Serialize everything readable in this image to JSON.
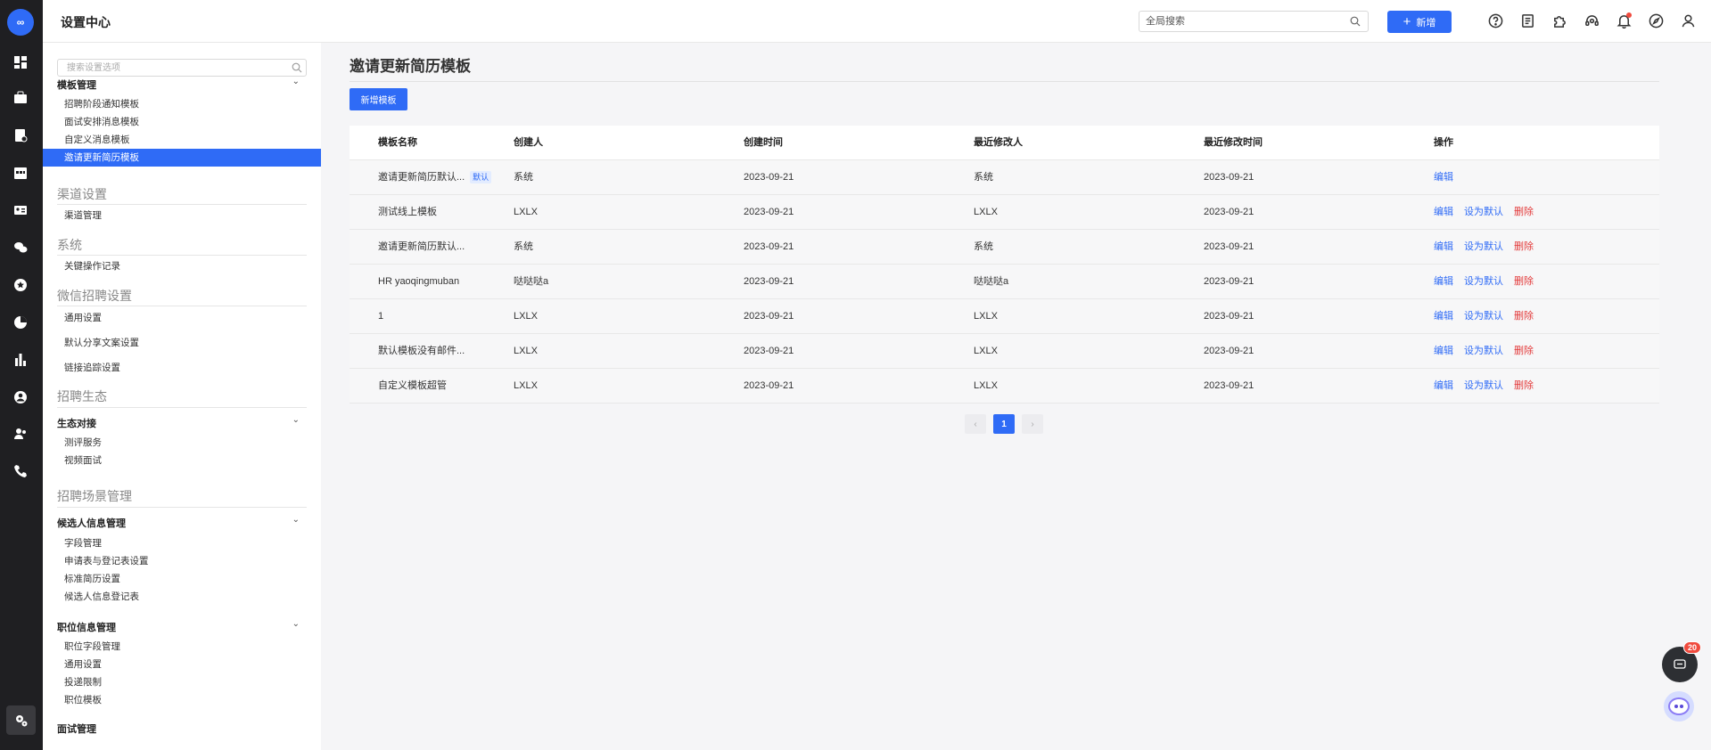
{
  "app": {
    "logo_text": "∞",
    "title": "设置中心"
  },
  "header": {
    "search_placeholder": "全局搜索",
    "new_label": "新增"
  },
  "sidebar": {
    "search_placeholder": "搜索设置选项",
    "template_group": "模板管理",
    "template_items": [
      "招聘阶段通知模板",
      "面试安排消息模板",
      "自定义消息模板",
      "邀请更新简历模板"
    ],
    "channel_section": "渠道设置",
    "channel_items": [
      "渠道管理"
    ],
    "system_section": "系统",
    "system_items": [
      "关键操作记录"
    ],
    "wechat_section": "微信招聘设置",
    "wechat_items": [
      "通用设置",
      "默认分享文案设置",
      "链接追踪设置"
    ],
    "eco_section": "招聘生态",
    "eco_group": "生态对接",
    "eco_items": [
      "测评服务",
      "视频面试"
    ],
    "scene_section": "招聘场景管理",
    "candidate_group": "候选人信息管理",
    "candidate_items": [
      "字段管理",
      "申请表与登记表设置",
      "标准简历设置",
      "候选人信息登记表"
    ],
    "position_group": "职位信息管理",
    "position_items": [
      "职位字段管理",
      "通用设置",
      "投递限制",
      "职位模板"
    ],
    "cut_group": "面试管理"
  },
  "main": {
    "page_title": "邀请更新简历模板",
    "add_button": "新增模板",
    "columns": [
      "模板名称",
      "创建人",
      "创建时间",
      "最近修改人",
      "最近修改时间",
      "操作"
    ],
    "rows": [
      {
        "name": "邀请更新简历默认...",
        "tag": "默认",
        "creator": "系统",
        "created": "2023-09-21",
        "modifier": "系统",
        "modified": "2023-09-21",
        "actions": [
          "编辑"
        ]
      },
      {
        "name": "测试线上模板",
        "tag": "",
        "creator": "LXLX",
        "created": "2023-09-21",
        "modifier": "LXLX",
        "modified": "2023-09-21",
        "actions": [
          "编辑",
          "设为默认",
          "删除"
        ]
      },
      {
        "name": "邀请更新简历默认...",
        "tag": "",
        "creator": "系统",
        "created": "2023-09-21",
        "modifier": "系统",
        "modified": "2023-09-21",
        "actions": [
          "编辑",
          "设为默认",
          "删除"
        ]
      },
      {
        "name": "HR yaoqingmuban",
        "tag": "",
        "creator": "哒哒哒a",
        "created": "2023-09-21",
        "modifier": "哒哒哒a",
        "modified": "2023-09-21",
        "actions": [
          "编辑",
          "设为默认",
          "删除"
        ]
      },
      {
        "name": "1",
        "tag": "",
        "creator": "LXLX",
        "created": "2023-09-21",
        "modifier": "LXLX",
        "modified": "2023-09-21",
        "actions": [
          "编辑",
          "设为默认",
          "删除"
        ]
      },
      {
        "name": "默认模板没有邮件...",
        "tag": "",
        "creator": "LXLX",
        "created": "2023-09-21",
        "modifier": "LXLX",
        "modified": "2023-09-21",
        "actions": [
          "编辑",
          "设为默认",
          "删除"
        ]
      },
      {
        "name": "自定义模板超管",
        "tag": "",
        "creator": "LXLX",
        "created": "2023-09-21",
        "modifier": "LXLX",
        "modified": "2023-09-21",
        "actions": [
          "编辑",
          "设为默认",
          "删除"
        ]
      }
    ],
    "pagination": {
      "prev": "‹",
      "current": "1",
      "next": "›"
    }
  },
  "widgets": {
    "chat_badge": "20"
  },
  "colors": {
    "accent": "#2f6bf6",
    "danger": "#e33b3b",
    "rail": "#1f1f22"
  }
}
